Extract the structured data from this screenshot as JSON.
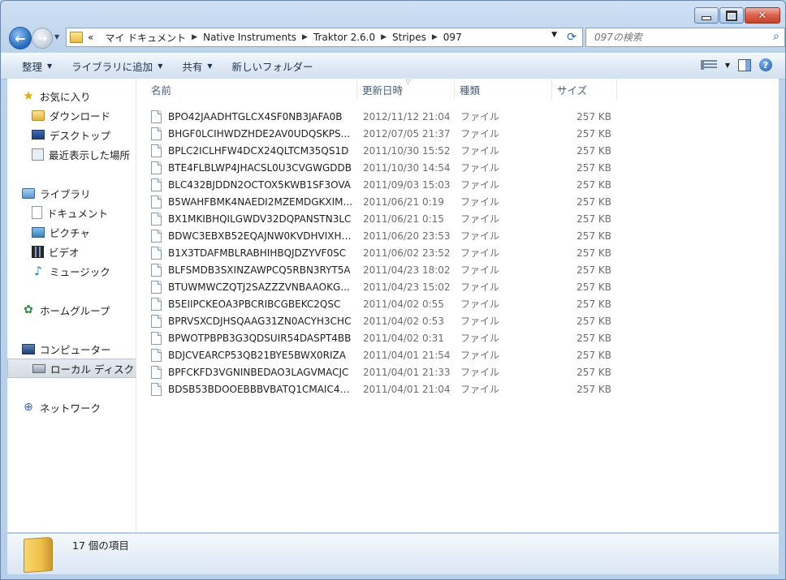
{
  "address": {
    "overflow": "«",
    "crumbs": [
      "マイ ドキュメント",
      "Native Instruments",
      "Traktor 2.6.0",
      "Stripes",
      "097"
    ]
  },
  "search": {
    "placeholder": "097の検索"
  },
  "toolbar": {
    "organize": "整理",
    "add_to_library": "ライブラリに追加",
    "share": "共有",
    "new_folder": "新しいフォルダー"
  },
  "nav": {
    "favorites": "お気に入り",
    "downloads": "ダウンロード",
    "desktop": "デスクトップ",
    "recent": "最近表示した場所",
    "libraries": "ライブラリ",
    "documents": "ドキュメント",
    "pictures": "ピクチャ",
    "videos": "ビデオ",
    "music": "ミュージック",
    "homegroup": "ホームグループ",
    "computer": "コンピューター",
    "local_disk": "ローカル ディスク (",
    "network": "ネットワーク"
  },
  "columns": {
    "name": "名前",
    "date": "更新日時",
    "type": "種類",
    "size": "サイズ"
  },
  "files": [
    {
      "name": "BPO42JAADHTGLCX4SF0NB3JAFA0B",
      "date": "2012/11/12 21:04",
      "type": "ファイル",
      "size": "257 KB"
    },
    {
      "name": "BHGF0LCIHWDZHDE2AV0UDQSKPS...",
      "date": "2012/07/05 21:37",
      "type": "ファイル",
      "size": "257 KB"
    },
    {
      "name": "BPLC2ICLHFW4DCX24QLTCM35QS1D",
      "date": "2011/10/30 15:52",
      "type": "ファイル",
      "size": "257 KB"
    },
    {
      "name": "BTE4FLBLWP4JHACSL0U3CVGWGDDB",
      "date": "2011/10/30 14:54",
      "type": "ファイル",
      "size": "257 KB"
    },
    {
      "name": "BLC432BJDDN2OCTOX5KWB1SF3OVA",
      "date": "2011/09/03 15:03",
      "type": "ファイル",
      "size": "257 KB"
    },
    {
      "name": "B5WAHFBMK4NAEDI2MZEMDGKXIM...",
      "date": "2011/06/21 0:19",
      "type": "ファイル",
      "size": "257 KB"
    },
    {
      "name": "BX1MKIBHQILGWDV32DQPANSTN3LC",
      "date": "2011/06/21 0:15",
      "type": "ファイル",
      "size": "257 KB"
    },
    {
      "name": "BDWC3EBXB52EQAJNW0KVDHVIXHAB",
      "date": "2011/06/20 23:53",
      "type": "ファイル",
      "size": "257 KB"
    },
    {
      "name": "B1X3TDAFMBLRABHIHBQJDZYVF0SC",
      "date": "2011/06/02 23:52",
      "type": "ファイル",
      "size": "257 KB"
    },
    {
      "name": "BLFSMDB3SXINZAWPCQ5RBN3RYT5A",
      "date": "2011/04/23 18:02",
      "type": "ファイル",
      "size": "257 KB"
    },
    {
      "name": "BTUWMWCZQTJ2SAZZZVNBAAOKG...",
      "date": "2011/04/23 15:02",
      "type": "ファイル",
      "size": "257 KB"
    },
    {
      "name": "B5EIIPCKEOA3PBCRIBCGBEKC2QSC",
      "date": "2011/04/02 0:55",
      "type": "ファイル",
      "size": "257 KB"
    },
    {
      "name": "BPRVSXCDJHSQAAG31ZN0ACYH3CHC",
      "date": "2011/04/02 0:53",
      "type": "ファイル",
      "size": "257 KB"
    },
    {
      "name": "BPWOTPBPB3G3QDSUIR54DASPT4BB",
      "date": "2011/04/02 0:31",
      "type": "ファイル",
      "size": "257 KB"
    },
    {
      "name": "BDJCVEARCP53QB21BYE5BWX0RIZA",
      "date": "2011/04/01 21:54",
      "type": "ファイル",
      "size": "257 KB"
    },
    {
      "name": "BPFCKFD3VGNINBEDAO3LAGVMACJC",
      "date": "2011/04/01 21:33",
      "type": "ファイル",
      "size": "257 KB"
    },
    {
      "name": "BDSB53BDOOEBBBVBATQ1CMAIC4DC",
      "date": "2011/04/01 21:04",
      "type": "ファイル",
      "size": "257 KB"
    }
  ],
  "status": {
    "count": "17 個の項目"
  }
}
